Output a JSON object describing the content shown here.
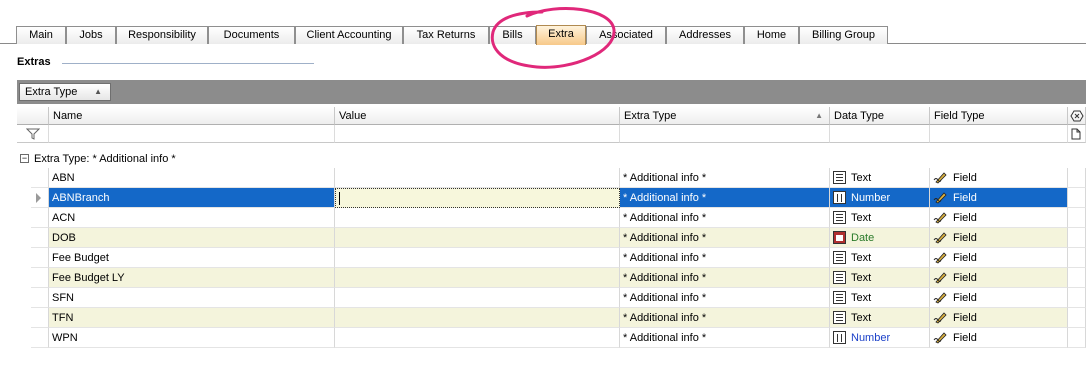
{
  "tabs": [
    {
      "label": "Main",
      "active": false
    },
    {
      "label": "Jobs",
      "active": false
    },
    {
      "label": "Responsibility",
      "active": false
    },
    {
      "label": "Documents",
      "active": false
    },
    {
      "label": "Client Accounting",
      "active": false
    },
    {
      "label": "Tax Returns",
      "active": false
    },
    {
      "label": "Bills",
      "active": false
    },
    {
      "label": "Extra",
      "active": true
    },
    {
      "label": "Associated",
      "active": false
    },
    {
      "label": "Addresses",
      "active": false
    },
    {
      "label": "Home",
      "active": false
    },
    {
      "label": "Billing Group",
      "active": false
    }
  ],
  "section": {
    "title": "Extras"
  },
  "group_by": {
    "chip_label": "Extra Type"
  },
  "grid": {
    "columns": [
      "Name",
      "Value",
      "Extra Type",
      "Data Type",
      "Field Type"
    ],
    "group_row_label": "Extra Type: * Additional info *",
    "rows": [
      {
        "name": "ABN",
        "value": "",
        "extra_type": "* Additional info *",
        "data_type": "Text",
        "field_type": "Field"
      },
      {
        "name": "ABNBranch",
        "value": "",
        "extra_type": "* Additional info *",
        "data_type": "Number",
        "field_type": "Field"
      },
      {
        "name": "ACN",
        "value": "",
        "extra_type": "* Additional info *",
        "data_type": "Text",
        "field_type": "Field"
      },
      {
        "name": "DOB",
        "value": "",
        "extra_type": "* Additional info *",
        "data_type": "Date",
        "field_type": "Field"
      },
      {
        "name": "Fee Budget",
        "value": "",
        "extra_type": "* Additional info *",
        "data_type": "Text",
        "field_type": "Field"
      },
      {
        "name": "Fee Budget LY",
        "value": "",
        "extra_type": "* Additional info *",
        "data_type": "Text",
        "field_type": "Field"
      },
      {
        "name": "SFN",
        "value": "",
        "extra_type": "* Additional info *",
        "data_type": "Text",
        "field_type": "Field"
      },
      {
        "name": "TFN",
        "value": "",
        "extra_type": "* Additional info *",
        "data_type": "Text",
        "field_type": "Field"
      },
      {
        "name": "WPN",
        "value": "",
        "extra_type": "* Additional info *",
        "data_type": "Number",
        "field_type": "Field"
      }
    ],
    "selected_row": "ABNBranch"
  },
  "colors": {
    "active_tab": "#f7c98a",
    "selected_row": "#1468c8",
    "alt_row": "#f4f4dc",
    "annotation_circle": "#e0287a"
  }
}
